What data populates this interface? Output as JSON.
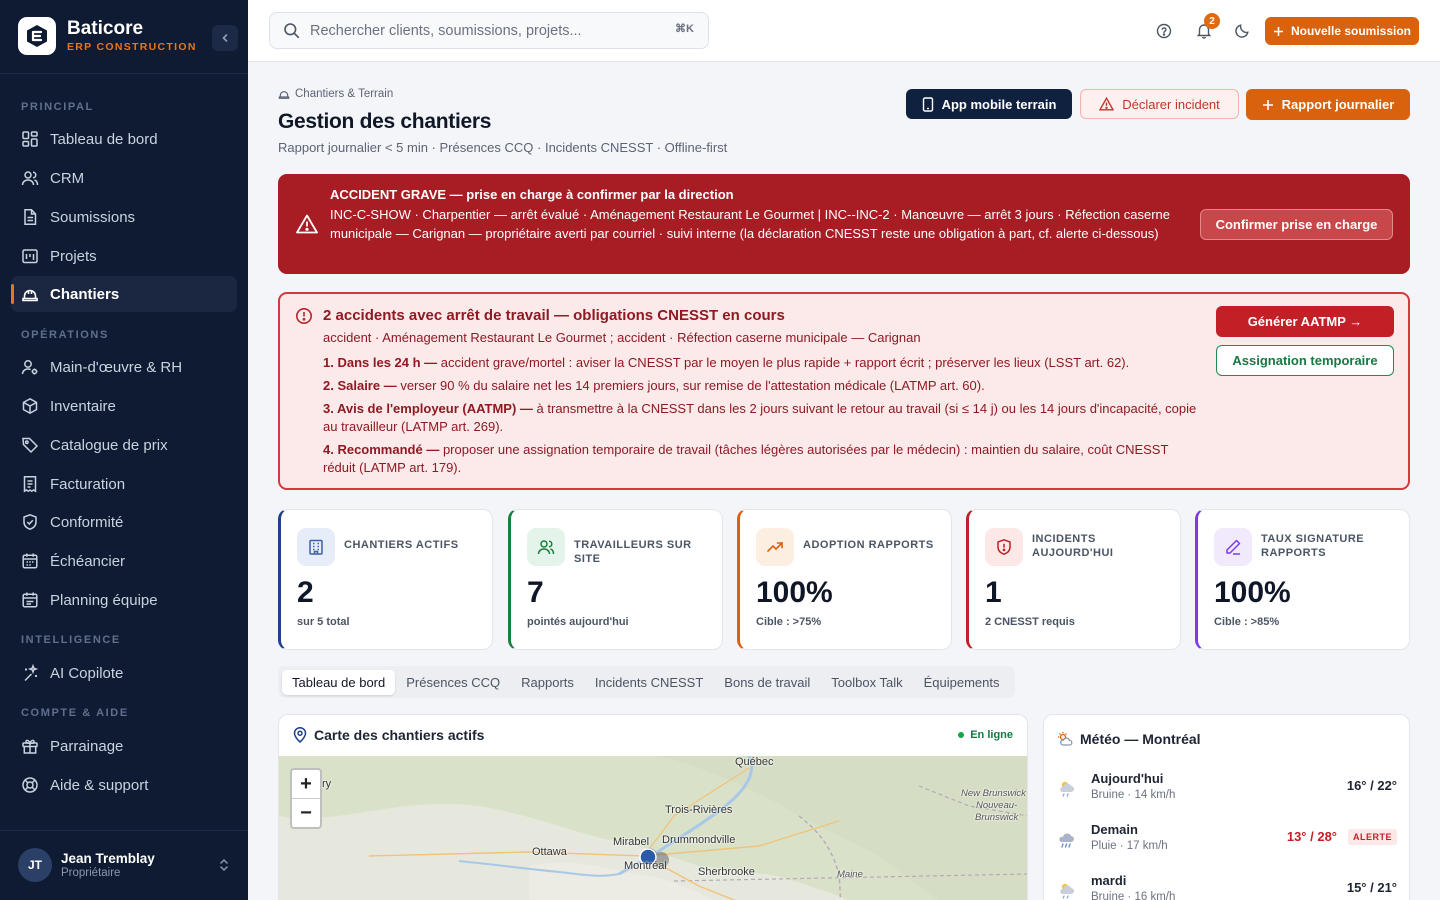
{
  "brand": {
    "name": "Baticore",
    "subtitle": "ERP CONSTRUCTION"
  },
  "sidebar": {
    "sections": [
      {
        "label": "PRINCIPAL",
        "items": [
          {
            "label": "Tableau de bord",
            "icon": "dashboard-icon"
          },
          {
            "label": "CRM",
            "icon": "users-icon"
          },
          {
            "label": "Soumissions",
            "icon": "file-text-icon"
          },
          {
            "label": "Projets",
            "icon": "projects-icon"
          },
          {
            "label": "Chantiers",
            "icon": "hard-hat-icon",
            "active": true
          }
        ]
      },
      {
        "label": "OPÉRATIONS",
        "items": [
          {
            "label": "Main-d'œuvre & RH",
            "icon": "user-cog-icon"
          },
          {
            "label": "Inventaire",
            "icon": "package-icon"
          },
          {
            "label": "Catalogue de prix",
            "icon": "tag-icon"
          },
          {
            "label": "Facturation",
            "icon": "receipt-icon"
          },
          {
            "label": "Conformité",
            "icon": "shield-check-icon"
          },
          {
            "label": "Échéancier",
            "icon": "calendar-icon"
          },
          {
            "label": "Planning équipe",
            "icon": "calendar-team-icon"
          }
        ]
      },
      {
        "label": "INTELLIGENCE",
        "items": [
          {
            "label": "AI Copilote",
            "icon": "sparkles-icon"
          }
        ]
      },
      {
        "label": "COMPTE & AIDE",
        "items": [
          {
            "label": "Parrainage",
            "icon": "gift-icon"
          },
          {
            "label": "Aide & support",
            "icon": "lifebuoy-icon"
          }
        ]
      }
    ],
    "user": {
      "initials": "JT",
      "name": "Jean Tremblay",
      "role": "Propriétaire"
    }
  },
  "topbar": {
    "search_placeholder": "Rechercher clients, soumissions, projets...",
    "shortcut": "⌘K",
    "notifications_count": "2",
    "new_button": "Nouvelle soumission"
  },
  "page": {
    "breadcrumb": "Chantiers & Terrain",
    "title": "Gestion des chantiers",
    "subtitle": "Rapport journalier < 5 min · Présences CCQ · Incidents CNESST · Offline-first",
    "actions": {
      "mobile": "App mobile terrain",
      "incident": "Déclarer incident",
      "report": "Rapport journalier"
    }
  },
  "alert_grave": {
    "title": "ACCIDENT GRAVE — prise en charge à confirmer par la direction",
    "body": "INC-C-SHOW · Charpentier — arrêt évalué · Aménagement Restaurant Le Gourmet | INC--INC-2 · Manœuvre — arrêt 3 jours · Réfection caserne municipale — Carignan — propriétaire averti par courriel · suivi interne (la déclaration CNESST reste une obligation à part, cf. alerte ci-dessous)",
    "button": "Confirmer prise en charge"
  },
  "alert_cnesst": {
    "title": "2 accidents avec arrêt de travail — obligations CNESST en cours",
    "subtitle": "accident · Aménagement Restaurant Le Gourmet ; accident · Réfection caserne municipale — Carignan",
    "items": [
      {
        "lead": "1. Dans les 24 h —",
        "text": " accident grave/mortel : aviser la CNESST par le moyen le plus rapide + rapport écrit ; préserver les lieux (LSST art. 62)."
      },
      {
        "lead": "2. Salaire —",
        "text": " verser 90 % du salaire net les 14 premiers jours, sur remise de l'attestation médicale (LATMP art. 60)."
      },
      {
        "lead": "3. Avis de l'employeur (AATMP) —",
        "text": " à transmettre à la CNESST dans les 2 jours suivant le retour au travail (si ≤ 14 j) ou les 14 jours d'incapacité, copie au travailleur (LATMP art. 269)."
      },
      {
        "lead": "4. Recommandé —",
        "text": " proposer une assignation temporaire de travail (tâches légères autorisées par le médecin) : maintien du salaire, coût CNESST réduit (LATMP art. 179)."
      }
    ],
    "button_primary": "Générer AATMP →",
    "button_secondary": "Assignation temporaire"
  },
  "kpis": [
    {
      "label": "CHANTIERS ACTIFS",
      "value": "2",
      "sub": "sur 5 total",
      "color": "#1f3f8f",
      "icon": "building-icon"
    },
    {
      "label": "TRAVAILLEURS SUR SITE",
      "value": "7",
      "sub": "pointés aujourd'hui",
      "color": "#16803d",
      "icon": "users-icon"
    },
    {
      "label": "ADOPTION RAPPORTS",
      "value": "100%",
      "sub": "Cible : >75%",
      "color": "#d8620e",
      "icon": "trending-up-icon"
    },
    {
      "label": "INCIDENTS AUJOURD'HUI",
      "value": "1",
      "sub": "2 CNESST requis",
      "color": "#c21f27",
      "icon": "shield-alert-icon"
    },
    {
      "label": "TAUX SIGNATURE RAPPORTS",
      "value": "100%",
      "sub": "Cible : >85%",
      "color": "#7c3aed",
      "icon": "pen-icon"
    }
  ],
  "tabs": [
    "Tableau de bord",
    "Présences CCQ",
    "Rapports",
    "Incidents CNESST",
    "Bons de travail",
    "Toolbox Talk",
    "Équipements"
  ],
  "map": {
    "title": "Carte des chantiers actifs",
    "status": "En ligne",
    "labels": {
      "quebec": "Québec",
      "trois_rivieres": "Trois-Rivières",
      "drummondville": "Drummondville",
      "mirabel": "Mirabel",
      "ottawa": "Ottawa",
      "montreal": "Montréal",
      "sherbrooke": "Sherbrooke",
      "maine": "Maine",
      "nb1": "New Brunswick",
      "nb2": "Nouveau-",
      "nb3": "Brunswick",
      "partial": "ry"
    }
  },
  "weather": {
    "title": "Météo — Montréal",
    "days": [
      {
        "day": "Aujourd'hui",
        "desc": "Bruine · 14 km/h",
        "temp": "16°  /  22°"
      },
      {
        "day": "Demain",
        "desc": "Pluie · 17 km/h",
        "temp": "13°  /  28°",
        "alert": "ALERTE"
      },
      {
        "day": "mardi",
        "desc": "Bruine · 16 km/h",
        "temp": "15°  /  21°"
      }
    ]
  }
}
